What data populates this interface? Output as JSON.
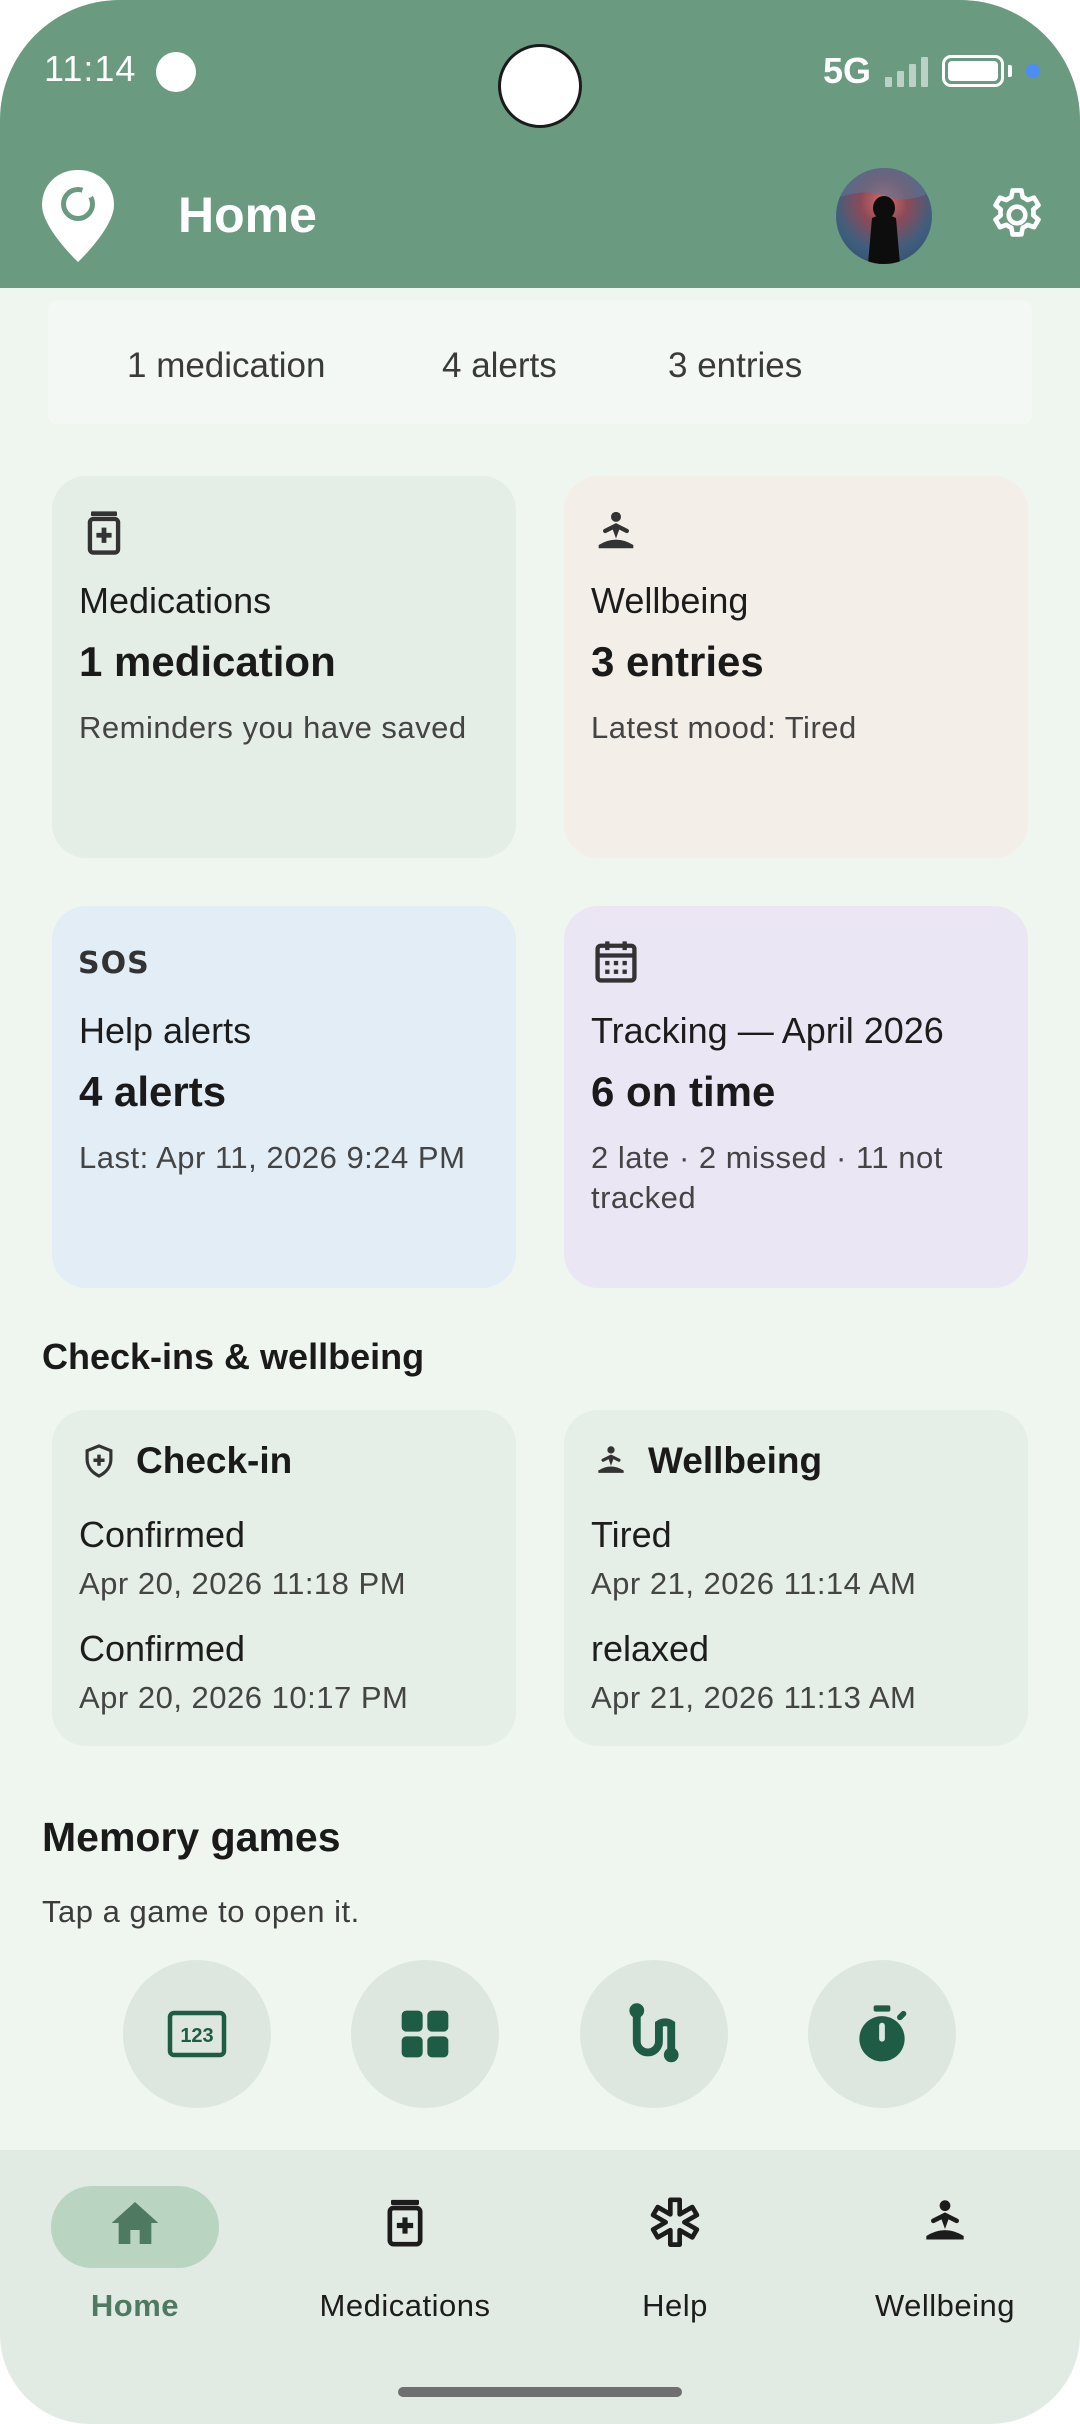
{
  "status_bar": {
    "time": "11:14",
    "network": "5G"
  },
  "app_bar": {
    "title": "Home"
  },
  "summary": {
    "medications": "1 medication",
    "alerts": "4 alerts",
    "entries": "3 entries"
  },
  "cards": {
    "medications": {
      "label": "Medications",
      "value": "1 medication",
      "sub": "Reminders you have saved",
      "bg": "#e5ede7"
    },
    "wellbeing": {
      "label": "Wellbeing",
      "value": "3 entries",
      "sub": "Latest mood: Tired",
      "bg": "#f3eee7"
    },
    "help_alerts": {
      "icon_text": "SOS",
      "label": "Help alerts",
      "value": "4 alerts",
      "sub": "Last: Apr 11, 2026 9:24 PM",
      "bg": "#e2edf6"
    },
    "tracking": {
      "label": "Tracking — April 2026",
      "value": "6 on time",
      "sub": "2 late · 2 missed · 11 not tracked",
      "bg": "#ebe6f4"
    }
  },
  "checkins_section": {
    "title": "Check-ins & wellbeing",
    "checkin": {
      "title": "Check-in",
      "items": [
        {
          "status": "Confirmed",
          "time": "Apr 20, 2026 11:18 PM"
        },
        {
          "status": "Confirmed",
          "time": "Apr 20, 2026 10:17 PM"
        }
      ]
    },
    "wellbeing": {
      "title": "Wellbeing",
      "items": [
        {
          "mood": "Tired",
          "time": "Apr 21, 2026 11:14 AM"
        },
        {
          "mood": "relaxed",
          "time": "Apr 21, 2026 11:13 AM"
        }
      ]
    }
  },
  "games": {
    "title": "Memory games",
    "note": "Tap a game to open it.",
    "number_icon_text": "123"
  },
  "bottom_nav": {
    "home": "Home",
    "medications": "Medications",
    "help": "Help",
    "wellbeing": "Wellbeing"
  },
  "colors": {
    "header": "#6a9a80",
    "accent_dark": "#1f5c45",
    "active_nav_pill": "#b9d4c1"
  }
}
